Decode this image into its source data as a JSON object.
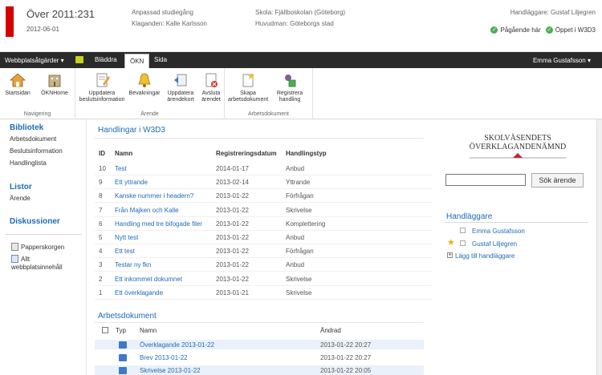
{
  "header": {
    "title": "Över 2011:231",
    "date": "2012-06-01",
    "process": "Anpassad studiegång",
    "complainant": "Klaganden: Kalle Karlsson",
    "school": "Skola: Fjällboskolan (Göteborg)",
    "principal": "Huvudman: Göteborgs stad",
    "handler": "Handläggare: Gustaf Liljegren",
    "status_ongoing": "Pågående här",
    "status_open": "Öppet i W3D3",
    "status_color": "#4caf50",
    "accent_color": "#d50000"
  },
  "topbar": {
    "site_actions": "Webbplatsåtgärder ▾",
    "tabs": [
      "Bläddra",
      "ÖKN",
      "Sida"
    ],
    "user": "Emma Gustafsson ▾"
  },
  "ribbon": {
    "groups": [
      {
        "label": "Navigering",
        "buttons": [
          "Startsidan",
          "ÖKNHome"
        ]
      },
      {
        "label": "Ärende",
        "buttons": [
          "Uppdatera beslutsinformation",
          "Bevakningar",
          "Uppdatera ärendekort",
          "Avsluta ärendet"
        ]
      },
      {
        "label": "Arbetsdokument",
        "buttons": [
          "Skapa arbetsdokument",
          "Registrera handling"
        ]
      }
    ]
  },
  "leftnav": {
    "library_head": "Bibliotek",
    "library_items": [
      "Arbetsdokument",
      "Beslutsinformation",
      "Handlinglista"
    ],
    "lists_head": "Listor",
    "lists_items": [
      "Ärende"
    ],
    "discussions_head": "Diskussioner",
    "recycle": "Papperskorgen",
    "all_content_1": "Allt",
    "all_content_2": "webbplatsinnehåll"
  },
  "handlingar": {
    "title": "Handlingar i W3D3",
    "headers": [
      "ID",
      "Namn",
      "Registreringsdatum",
      "Handlingstyp"
    ],
    "rows": [
      {
        "id": "10",
        "name": "Test",
        "date": "2014-01-17",
        "type": "Anbud"
      },
      {
        "id": "9",
        "name": "Ett yttrande",
        "date": "2013-02-14",
        "type": "Yttrande"
      },
      {
        "id": "8",
        "name": "Kanske nummer i headern?",
        "date": "2013-01-22",
        "type": "Förfrågan"
      },
      {
        "id": "7",
        "name": "Från Majken och Kalle",
        "date": "2013-01-22",
        "type": "Skrivelse"
      },
      {
        "id": "6",
        "name": "Handling med tre bifogade filer",
        "date": "2013-01-22",
        "type": "Komplettering"
      },
      {
        "id": "5",
        "name": "Nytt test",
        "date": "2013-01-22",
        "type": "Anbud"
      },
      {
        "id": "4",
        "name": "Ett test",
        "date": "2013-01-22",
        "type": "Förfrågan"
      },
      {
        "id": "3",
        "name": "Testar ny fkn",
        "date": "2013-01-22",
        "type": "Anbud"
      },
      {
        "id": "2",
        "name": "Ett inkommet dokumnet",
        "date": "2013-01-22",
        "type": "Skrivelse"
      },
      {
        "id": "1",
        "name": "Ett överklagande",
        "date": "2013-01-21",
        "type": "Skrivelse"
      }
    ]
  },
  "arbetsdokument": {
    "title": "Arbetsdokument",
    "headers": [
      "Typ",
      "Namn",
      "Ändrad"
    ],
    "rows": [
      {
        "name": "Överklagande 2013-01-22",
        "changed": "2013-01-22 20:27"
      },
      {
        "name": "Brev 2013-01-22",
        "changed": "2013-01-22 20:27"
      },
      {
        "name": "Skrivelse 2013-01-22",
        "changed": "2013-01-22 20:05"
      }
    ]
  },
  "rightpanel": {
    "logo_line1": "SKOLVÄSENDETS",
    "logo_line2": "ÖVERKLAGANDENÄMND",
    "search_value": "",
    "search_button": "Sök ärende",
    "handlers_head": "Handläggare",
    "handlers": [
      "Emma Gustafsson",
      "Gustaf Liljegren"
    ],
    "add_handler": "Lägg till handläggare"
  }
}
